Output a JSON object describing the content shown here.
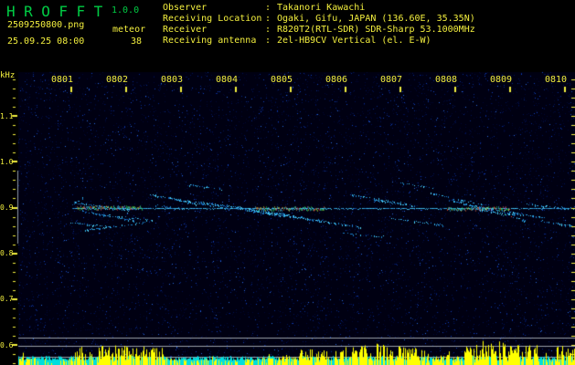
{
  "header": {
    "app_title": "HROFFT",
    "version": "1.0.0",
    "filename": "2509250800.png",
    "mode": "meteor",
    "datetime": "25.09.25 08:00",
    "echo_count": "38"
  },
  "info_panel": {
    "rows": [
      {
        "label": "Observer",
        "sep": ":",
        "value": "Takanori Kawachi"
      },
      {
        "label": "Receiving Location",
        "sep": ":",
        "value": "Ogaki, Gifu, JAPAN (136.60E, 35.35N)"
      },
      {
        "label": "Receiver",
        "sep": ":",
        "value": "R820T2(RTL-SDR) SDR-Sharp 53.1000MHz"
      },
      {
        "label": "Receiving antenna",
        "sep": ":",
        "value": "2el-HB9CV Vertical (el. E-W)"
      }
    ]
  },
  "chart_data": {
    "type": "heatmap",
    "subtype": "radio-meteor-spectrogram",
    "ylabel": "kHz",
    "xlabel": "",
    "x_ticks": [
      "0801",
      "0802",
      "0803",
      "0804",
      "0805",
      "0806",
      "0807",
      "0808",
      "0809",
      "0810"
    ],
    "y_ticks": [
      "1.1",
      "1.0",
      "0.9",
      "0.8",
      "0.7",
      "0.6"
    ],
    "y_minor_step_khz": 0.02,
    "y_range_khz": [
      0.56,
      1.2
    ],
    "x_range_min": [
      0,
      10.2
    ],
    "carrier": {
      "freq_khz": 0.9,
      "t_start_min": 1.0,
      "t_end_min": 10.2
    },
    "hot_segments": [
      {
        "t1": 1.1,
        "t2": 2.3,
        "f": 0.901
      },
      {
        "t1": 4.35,
        "t2": 5.65,
        "f": 0.899
      },
      {
        "t1": 7.85,
        "t2": 9.0,
        "f": 0.899
      }
    ],
    "echo_streaks": [
      {
        "t1": 1.0,
        "f1": 0.905,
        "t2": 1.25,
        "f2": 0.925,
        "i": 0.5
      },
      {
        "t1": 1.05,
        "f1": 0.912,
        "t2": 2.0,
        "f2": 0.895,
        "i": 0.9
      },
      {
        "t1": 1.15,
        "f1": 0.895,
        "t2": 2.15,
        "f2": 0.872,
        "i": 0.7
      },
      {
        "t1": 1.0,
        "f1": 0.868,
        "t2": 1.75,
        "f2": 0.858,
        "i": 0.5
      },
      {
        "t1": 1.25,
        "f1": 0.852,
        "t2": 2.35,
        "f2": 0.868,
        "i": 0.5
      },
      {
        "t1": 2.02,
        "f1": 0.9,
        "t2": 2.06,
        "f2": 0.868,
        "i": 0.6
      },
      {
        "t1": 1.6,
        "f1": 0.885,
        "t2": 2.5,
        "f2": 0.873,
        "i": 0.5
      },
      {
        "t1": 2.45,
        "f1": 0.93,
        "t2": 3.3,
        "f2": 0.908,
        "i": 0.6
      },
      {
        "t1": 2.8,
        "f1": 0.922,
        "t2": 3.9,
        "f2": 0.898,
        "i": 0.6
      },
      {
        "t1": 2.55,
        "f1": 0.905,
        "t2": 3.1,
        "f2": 0.897,
        "i": 0.5
      },
      {
        "t1": 3.35,
        "f1": 0.912,
        "t2": 4.35,
        "f2": 0.897,
        "i": 0.7
      },
      {
        "t1": 3.8,
        "f1": 0.905,
        "t2": 5.0,
        "f2": 0.885,
        "i": 0.7
      },
      {
        "t1": 4.05,
        "f1": 0.898,
        "t2": 5.3,
        "f2": 0.878,
        "i": 0.6
      },
      {
        "t1": 4.3,
        "f1": 0.893,
        "t2": 6.3,
        "f2": 0.858,
        "i": 0.7
      },
      {
        "t1": 4.55,
        "f1": 0.888,
        "t2": 5.6,
        "f2": 0.872,
        "i": 0.5
      },
      {
        "t1": 3.1,
        "f1": 0.952,
        "t2": 3.75,
        "f2": 0.94,
        "i": 0.4
      },
      {
        "t1": 5.9,
        "f1": 0.845,
        "t2": 6.7,
        "f2": 0.837,
        "i": 0.4
      },
      {
        "t1": 6.1,
        "f1": 0.928,
        "t2": 7.1,
        "f2": 0.91,
        "i": 0.6
      },
      {
        "t1": 6.5,
        "f1": 0.917,
        "t2": 7.3,
        "f2": 0.904,
        "i": 0.5
      },
      {
        "t1": 6.8,
        "f1": 0.878,
        "t2": 7.8,
        "f2": 0.862,
        "i": 0.5
      },
      {
        "t1": 7.55,
        "f1": 0.932,
        "t2": 8.5,
        "f2": 0.908,
        "i": 0.7
      },
      {
        "t1": 7.9,
        "f1": 0.918,
        "t2": 9.3,
        "f2": 0.872,
        "i": 0.8
      },
      {
        "t1": 8.15,
        "f1": 0.908,
        "t2": 9.65,
        "f2": 0.878,
        "i": 0.7
      },
      {
        "t1": 8.45,
        "f1": 0.895,
        "t2": 9.15,
        "f2": 0.885,
        "i": 0.6
      },
      {
        "t1": 9.3,
        "f1": 0.908,
        "t2": 10.2,
        "f2": 0.898,
        "i": 0.6
      },
      {
        "t1": 9.55,
        "f1": 0.872,
        "t2": 10.2,
        "f2": 0.86,
        "i": 0.5
      },
      {
        "t1": 7.0,
        "f1": 0.955,
        "t2": 7.7,
        "f2": 0.942,
        "i": 0.35
      }
    ],
    "level_meter": {
      "envelope": [
        0.25,
        0.2,
        0.2,
        0.7,
        0.8,
        0.75,
        0.7,
        0.65,
        0.2,
        0.15,
        0.2,
        0.15,
        0.2,
        0.25,
        0.3,
        0.6,
        0.55,
        0.8,
        0.85,
        0.8,
        0.75,
        0.7,
        0.4,
        0.35,
        0.85,
        0.9,
        0.85,
        0.8,
        0.25,
        0.7
      ],
      "ref_line_y": [
        370,
        379,
        391
      ]
    },
    "colors": {
      "title_green": "#00cc44",
      "axis_yellow": "#f3ef3e",
      "meter_bar_yellow": "#ffff00",
      "meter_band_cyan": "#00dede",
      "ref_line_gray": "#9aa0a8",
      "trace_cyan": "#35b5e8",
      "background": "#000000"
    }
  }
}
